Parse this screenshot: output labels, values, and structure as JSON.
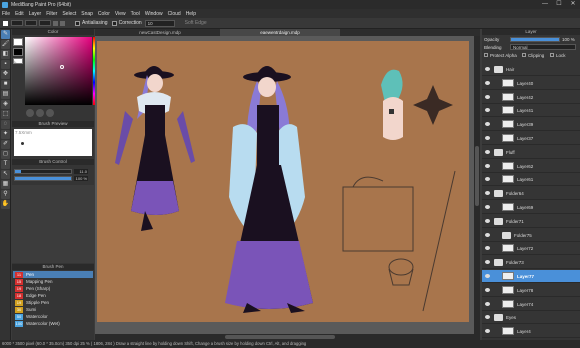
{
  "titlebar": {
    "title": "MediBang Paint Pro (64bit)",
    "min": "—",
    "max": "☐",
    "close": "✕"
  },
  "menu": [
    "File",
    "Edit",
    "Layer",
    "Filter",
    "Select",
    "Snap",
    "Color",
    "View",
    "Tool",
    "Window",
    "Cloud",
    "Help"
  ],
  "toolbar": {
    "antialias_label": "Antialiasing",
    "correction_label": "Correction",
    "correction_value": "10",
    "soft_edge_label": "Soft Edge"
  },
  "tools": [
    "pen-icon",
    "brush-icon",
    "eraser-icon",
    "dot-icon",
    "move-icon",
    "fill-icon",
    "gradient-icon",
    "bucket-icon",
    "select-icon",
    "lasso-icon",
    "magic-wand-icon",
    "select-pen-icon",
    "select-eraser-icon",
    "text-icon",
    "operation-icon",
    "divide-icon",
    "eyedropper-icon",
    "hand-icon"
  ],
  "color_panel": {
    "title": "Color",
    "primary": "#ffffff",
    "secondary": "#000000"
  },
  "brush_preview": {
    "title": "Brush Preview",
    "size": "7.5Xmm"
  },
  "brush_control": {
    "title": "Brush Control",
    "size_value": "11.0",
    "opacity_value": "100 %",
    "size_fraction": 0.11,
    "opacity_fraction": 1.0
  },
  "brush_list": {
    "title": "Brush Pen",
    "items": [
      {
        "num": "11",
        "name": "Pen",
        "color": "#d43030"
      },
      {
        "num": "15",
        "name": "Mapping Pen",
        "color": "#d43030"
      },
      {
        "num": "19",
        "name": "Pen (Sharp)",
        "color": "#d43030"
      },
      {
        "num": "18",
        "name": "Edge Pen",
        "color": "#d43030"
      },
      {
        "num": "19",
        "name": "Stipple Pen",
        "color": "#d0a020"
      },
      {
        "num": "30",
        "name": "Sumi",
        "color": "#d0a020"
      },
      {
        "num": "50",
        "name": "Watercolor",
        "color": "#4aa3df"
      },
      {
        "num": "100",
        "name": "Watercolor (Wet)",
        "color": "#4aa3df"
      }
    ]
  },
  "tabs": [
    {
      "label": "newCastDesign.mdp",
      "active": false
    },
    {
      "label": "eaewentrdaign.mdp",
      "active": true
    }
  ],
  "layer_panel": {
    "title": "Layer",
    "opacity_label": "Opacity",
    "opacity_value": "100 %",
    "blending_label": "Blending",
    "blending_value": "Normal",
    "protect_alpha_label": "Protect Alpha",
    "clipping_label": "Clipping",
    "lock_label": "Lock",
    "layers": [
      {
        "name": "Hair",
        "type": "folder",
        "indent": 0,
        "selected": false
      },
      {
        "name": "Layer40",
        "type": "layer",
        "indent": 1,
        "selected": false
      },
      {
        "name": "Layer42",
        "type": "layer",
        "indent": 1,
        "selected": false
      },
      {
        "name": "Layer41",
        "type": "layer",
        "indent": 1,
        "selected": false
      },
      {
        "name": "Layer39",
        "type": "layer",
        "indent": 1,
        "selected": false
      },
      {
        "name": "Layer37",
        "type": "layer",
        "indent": 1,
        "selected": false
      },
      {
        "name": "Fluff",
        "type": "folder",
        "indent": 0,
        "selected": false
      },
      {
        "name": "Layer62",
        "type": "layer",
        "indent": 1,
        "selected": false
      },
      {
        "name": "Layer61",
        "type": "layer",
        "indent": 1,
        "selected": false
      },
      {
        "name": "Folder64",
        "type": "folder",
        "indent": 0,
        "selected": false
      },
      {
        "name": "Layer69",
        "type": "layer",
        "indent": 1,
        "selected": false
      },
      {
        "name": "Folder71",
        "type": "folder",
        "indent": 0,
        "selected": false
      },
      {
        "name": "Folder75",
        "type": "folder",
        "indent": 1,
        "selected": false
      },
      {
        "name": "Layer72",
        "type": "layer",
        "indent": 1,
        "selected": false
      },
      {
        "name": "Folder73",
        "type": "folder",
        "indent": 0,
        "selected": false
      },
      {
        "name": "Layer77",
        "type": "layer",
        "indent": 1,
        "selected": true
      },
      {
        "name": "Layer78",
        "type": "layer",
        "indent": 1,
        "selected": false
      },
      {
        "name": "Layer74",
        "type": "layer",
        "indent": 1,
        "selected": false
      },
      {
        "name": "Eyes",
        "type": "folder",
        "indent": 0,
        "selected": false
      },
      {
        "name": "Layer4",
        "type": "layer",
        "indent": 1,
        "selected": false
      }
    ]
  },
  "statusbar": {
    "text": "6000 * 3500 pixel (60.0 * 35.0cm) 350 dpi  25 %  ( 1806, 284 )   Draw a straight line by holding down Shift, Change a brush size by holding down Ctrl, Alt, and dragging"
  }
}
